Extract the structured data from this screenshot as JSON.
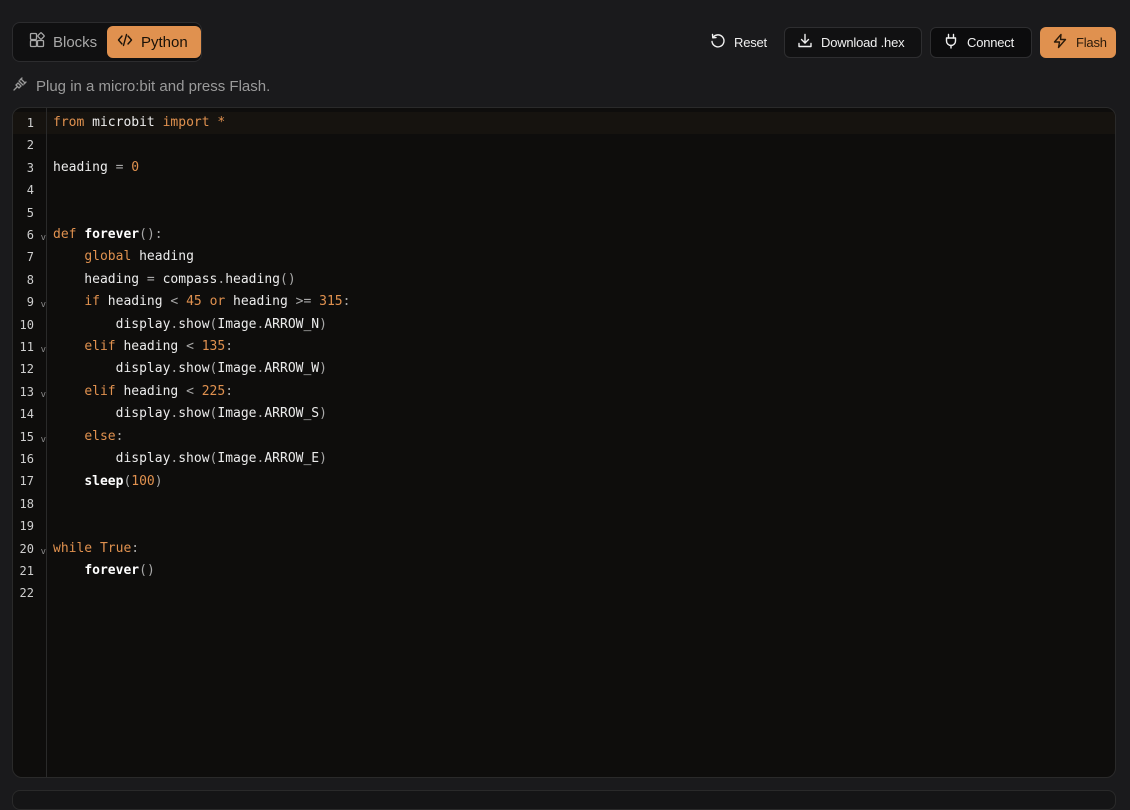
{
  "toolbar": {
    "modes": {
      "blocks_label": "Blocks",
      "python_label": "Python",
      "active": "Python"
    },
    "reset_label": "Reset",
    "download_label": "Download .hex",
    "connect_label": "Connect",
    "flash_label": "Flash"
  },
  "status": {
    "message": "Plug in a micro:bit and press Flash.",
    "icon": "plug-icon"
  },
  "colors": {
    "accent": "#e0914f",
    "background": "#1a1a1c",
    "editor_bg": "#0e0d0c"
  },
  "editor": {
    "language": "python",
    "active_line": 1,
    "fold_lines": [
      6,
      9,
      11,
      13,
      15,
      20
    ],
    "lines": [
      "from microbit import *",
      "",
      "heading = 0",
      "",
      "",
      "def forever():",
      "    global heading",
      "    heading = compass.heading()",
      "    if heading < 45 or heading >= 315:",
      "        display.show(Image.ARROW_N)",
      "    elif heading < 135:",
      "        display.show(Image.ARROW_W)",
      "    elif heading < 225:",
      "        display.show(Image.ARROW_S)",
      "    else:",
      "        display.show(Image.ARROW_E)",
      "    sleep(100)",
      "",
      "",
      "while True:",
      "    forever()",
      ""
    ]
  }
}
